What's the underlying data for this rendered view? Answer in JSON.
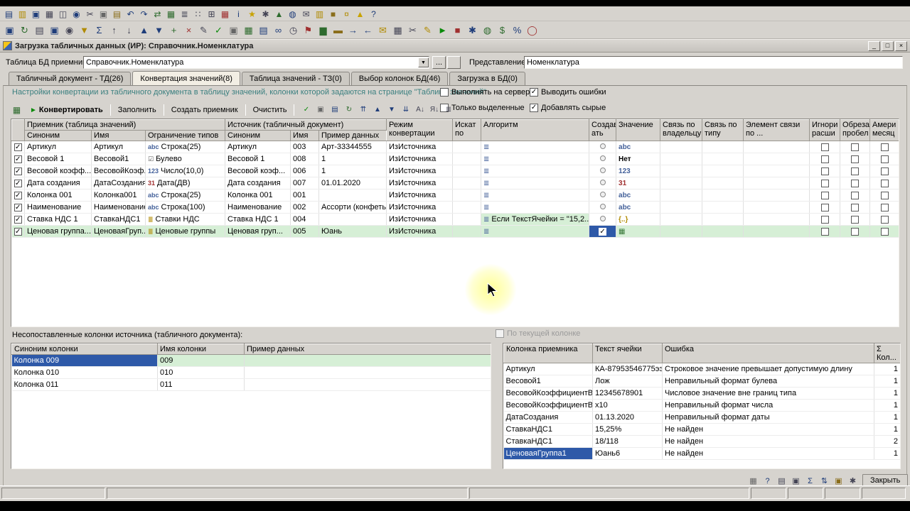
{
  "glyphs": {
    "check": "✓",
    "dropdown": "▼",
    "sigma": "Σ",
    "play": "►",
    "minimize": "_",
    "maximize": "□",
    "close": "×",
    "ellipsis": "...",
    "alg": "≣"
  },
  "window": {
    "title": "Загрузка табличных данных (ИР): Справочник.Номенклатура"
  },
  "form": {
    "table_label": "Таблица БД приемник:",
    "table_value": "Справочник.Номенклатура",
    "view_label": "Представление:",
    "view_value": "Номенклатура"
  },
  "tabs": [
    {
      "label": "Табличный документ - ТД(26)",
      "active": false
    },
    {
      "label": "Конвертация значений(8)",
      "active": true
    },
    {
      "label": "Таблица значений - ТЗ(0)",
      "active": false
    },
    {
      "label": "Выбор колонок БД(46)",
      "active": false
    },
    {
      "label": "Загрузка в БД(0)",
      "active": false
    }
  ],
  "info_text": "Настройки конвертации из табличного документа в таблицу значений, колонки которой задаются на странице \"Таблица значений\"",
  "options": {
    "run_on_server": {
      "label": "Выполнять на сервере",
      "checked": false
    },
    "show_errors": {
      "label": "Выводить ошибки",
      "checked": true
    },
    "only_selected": {
      "label": "Только выделенные",
      "checked": false
    },
    "add_raw": {
      "label": "Добавлять сырые",
      "checked": true
    }
  },
  "actions": {
    "convert": "Конвертировать",
    "fill": "Заполнить",
    "create_receiver": "Создать приемник",
    "clear": "Очистить"
  },
  "toolbars": {
    "row1": [
      [
        "new-document-icon",
        "▤",
        "#1f3d7a"
      ],
      [
        "open-icon",
        "▥",
        "#b08a00"
      ],
      [
        "save-icon",
        "▣",
        "#1f3d7a"
      ],
      [
        "print-icon",
        "▦",
        "#444455"
      ],
      [
        "print-preview-icon",
        "◫",
        "#444455"
      ],
      [
        "find-icon",
        "◉",
        "#1f3d7a"
      ],
      [
        "cut-icon",
        "✂",
        "#444455"
      ],
      [
        "copy-icon",
        "▣",
        "#666666"
      ],
      [
        "paste-icon",
        "▤",
        "#8a6d1a"
      ],
      [
        "undo-icon",
        "↶",
        "#1f3d7a"
      ],
      [
        "redo-icon",
        "↷",
        "#1f3d7a"
      ],
      [
        "compare-icon",
        "⇄",
        "#2e6b2e"
      ],
      [
        "table-icon",
        "▦",
        "#2e6b2e"
      ],
      [
        "list-icon",
        "≣",
        "#444455"
      ],
      [
        "tree-icon",
        "∷",
        "#444455"
      ],
      [
        "calculator-icon",
        "⊞",
        "#444455"
      ],
      [
        "calendar-icon",
        "▦",
        "#a03030"
      ],
      [
        "info-icon",
        "i",
        "#1f3d7a"
      ],
      [
        "star-icon",
        "★",
        "#c8a200"
      ],
      [
        "settings-icon",
        "✱",
        "#444455"
      ],
      [
        "chart-icon",
        "▲",
        "#2e6b2e"
      ],
      [
        "globe-icon",
        "◍",
        "#1f3d7a"
      ],
      [
        "mail-icon",
        "✉",
        "#444455"
      ],
      [
        "folder-icon",
        "▥",
        "#b08a00"
      ],
      [
        "lock-icon",
        "■",
        "#8a6d1a"
      ],
      [
        "key-icon",
        "¤",
        "#b08a00"
      ],
      [
        "warning-icon",
        "▲",
        "#c8a200"
      ],
      [
        "help-icon",
        "?",
        "#1f3d7a"
      ]
    ],
    "row2": [
      [
        "window-icon",
        "▣",
        "#1f3d7a"
      ],
      [
        "refresh-icon",
        "↻",
        "#2e6b2e"
      ],
      [
        "open-form-icon",
        "▤",
        "#444455"
      ],
      [
        "save-all-icon",
        "▣",
        "#1f3d7a"
      ],
      [
        "magnifier-icon",
        "◉",
        "#444455"
      ],
      [
        "filter-icon",
        "▼",
        "#b08a00"
      ],
      [
        "sum-icon",
        "Σ",
        "#1f3d7a"
      ],
      [
        "sort-asc-icon",
        "↑",
        "#444455"
      ],
      [
        "sort-desc-icon",
        "↓",
        "#444455"
      ],
      [
        "move-up-icon",
        "▲",
        "#1f3d7a"
      ],
      [
        "move-down-icon",
        "▼",
        "#1f3d7a"
      ],
      [
        "add-icon",
        "+",
        "#2e6b2e"
      ],
      [
        "delete-icon",
        "×",
        "#a03030"
      ],
      [
        "edit-icon",
        "✎",
        "#444455"
      ],
      [
        "check-icon",
        "✓",
        "#0a8a0a"
      ],
      [
        "copy-rows-icon",
        "▣",
        "#666666"
      ],
      [
        "excel-icon",
        "▦",
        "#2e6b2e"
      ],
      [
        "doc-icon",
        "▤",
        "#1f3d7a"
      ],
      [
        "link-icon",
        "∞",
        "#1f3d7a"
      ],
      [
        "clock-icon",
        "◷",
        "#444455"
      ],
      [
        "flag-icon",
        "⚑",
        "#a03030"
      ],
      [
        "chart-bars-icon",
        "▆",
        "#2e6b2e"
      ],
      [
        "database-icon",
        "▬",
        "#8a6d1a"
      ],
      [
        "export-icon",
        "→",
        "#1f3d7a"
      ],
      [
        "import-icon",
        "←",
        "#1f3d7a"
      ],
      [
        "mail-send-icon",
        "✉",
        "#b08a00"
      ],
      [
        "print-fast-icon",
        "▦",
        "#444455"
      ],
      [
        "scissors-icon",
        "✂",
        "#444455"
      ],
      [
        "brush-icon",
        "✎",
        "#b08a00"
      ],
      [
        "play-icon",
        "►",
        "#0a8a0a"
      ],
      [
        "stop-icon",
        "■",
        "#a03030"
      ],
      [
        "services-icon",
        "✱",
        "#1f3d7a"
      ],
      [
        "globe-web-icon",
        "◍",
        "#2e6b2e"
      ],
      [
        "money-icon",
        "$",
        "#2e6b2e"
      ],
      [
        "percent-icon",
        "%",
        "#1f3d7a"
      ],
      [
        "exit-icon",
        "◯",
        "#a03030"
      ]
    ],
    "action_icons": [
      [
        "check-document-icon",
        "✓",
        "#0a8a0a"
      ],
      [
        "copy-rows-icon",
        "▣",
        "#666666"
      ],
      [
        "new-row-icon",
        "▤",
        "#1f3d7a"
      ],
      [
        "refresh-rows-icon",
        "↻",
        "#2e6b2e"
      ],
      [
        "move-top-icon",
        "⇈",
        "#1f3d7a"
      ],
      [
        "move-up-icon",
        "▲",
        "#1f3d7a"
      ],
      [
        "move-down-icon",
        "▼",
        "#1f3d7a"
      ],
      [
        "move-bottom-icon",
        "⇊",
        "#1f3d7a"
      ],
      [
        "sort-az-icon",
        "А↓",
        "#444455"
      ],
      [
        "sort-za-icon",
        "Я↓",
        "#444455"
      ],
      [
        "list-icon",
        "≣",
        "#444455"
      ]
    ],
    "bottom_icons": [
      [
        "grid-settings-icon",
        "▦",
        "#666666"
      ],
      [
        "help-icon",
        "?",
        "#1f3d7a"
      ],
      [
        "document-icon",
        "▤",
        "#444455"
      ],
      [
        "documents-icon",
        "▣",
        "#444455"
      ],
      [
        "sum-icon",
        "Σ",
        "#1f3d7a"
      ],
      [
        "updown-icon",
        "⇅",
        "#1f3d7a"
      ],
      [
        "save-icon",
        "▣",
        "#8a6d1a"
      ],
      [
        "settings-icon",
        "✱",
        "#444455"
      ]
    ]
  },
  "main_table": {
    "groups": {
      "receiver": "Приемник (таблица значений)",
      "source": "Источник (табличный документ)"
    },
    "headers": {
      "syn": "Синоним",
      "name": "Имя",
      "type": "Ограничение типов",
      "src_syn": "Синоним",
      "src_name": "Имя",
      "sample": "Пример данных",
      "mode": "Режим конвертации",
      "search": "Искат по",
      "alg": "Алгоритм",
      "create": "Создав ать",
      "value": "Значение",
      "owner": "Связь по владельцу",
      "link_type": "Связь по типу",
      "element": "Элемент связи по ...",
      "ignore": "Игнори расши",
      "trim": "Обреза пробел",
      "amer": "Амери месяц"
    },
    "rows": [
      {
        "checked": true,
        "syn": "Артикул",
        "name": "Артикул",
        "type_glyph": "abc",
        "type_color": "#44619a",
        "type": "Строка(25)",
        "src_syn": "Артикул",
        "src_name": "003",
        "sample": "Арт-33344555",
        "mode": "ИзИсточника",
        "alg": "",
        "alg_green": false,
        "create_checked": false,
        "value_glyph": "abc",
        "value_color": "#44619a",
        "green": false
      },
      {
        "checked": true,
        "syn": "Весовой 1",
        "name": "Весовой1",
        "type_glyph": "☑",
        "type_color": "#555555",
        "type": "Булево",
        "src_syn": "Весовой 1",
        "src_name": "008",
        "sample": "1",
        "mode": "ИзИсточника",
        "alg": "",
        "alg_green": false,
        "create_checked": false,
        "value_glyph": "Нет",
        "value_color": "#000000",
        "green": false
      },
      {
        "checked": true,
        "syn": "Весовой коэфф...",
        "name": "ВесовойКоэф...",
        "type_glyph": "123",
        "type_color": "#44619a",
        "type": "Число(10,0)",
        "src_syn": "Весовой коэф...",
        "src_name": "006",
        "sample": "1",
        "mode": "ИзИсточника",
        "alg": "",
        "alg_green": false,
        "create_checked": false,
        "value_glyph": "123",
        "value_color": "#44619a",
        "green": false
      },
      {
        "checked": true,
        "syn": "Дата создания",
        "name": "ДатаСоздания",
        "type_glyph": "31",
        "type_color": "#a03030",
        "type": "Дата(ДВ)",
        "src_syn": "Дата создания",
        "src_name": "007",
        "sample": "01.01.2020",
        "mode": "ИзИсточника",
        "alg": "",
        "alg_green": false,
        "create_checked": false,
        "value_glyph": "31",
        "value_color": "#a03030",
        "green": false
      },
      {
        "checked": true,
        "syn": "Колонка 001",
        "name": "Колонка001",
        "type_glyph": "abc",
        "type_color": "#44619a",
        "type": "Строка(25)",
        "src_syn": "Колонка 001",
        "src_name": "001",
        "sample": "",
        "mode": "ИзИсточника",
        "alg": "",
        "alg_green": false,
        "create_checked": false,
        "value_glyph": "abc",
        "value_color": "#44619a",
        "green": false
      },
      {
        "checked": true,
        "syn": "Наименование",
        "name": "Наименование",
        "type_glyph": "abc",
        "type_color": "#44619a",
        "type": "Строка(100)",
        "src_syn": "Наименование",
        "src_name": "002",
        "sample": "Ассорти (конфеты)...",
        "mode": "ИзИсточника",
        "alg": "",
        "alg_green": false,
        "create_checked": false,
        "value_glyph": "abc",
        "value_color": "#44619a",
        "green": false
      },
      {
        "checked": true,
        "syn": "Ставка НДС 1",
        "name": "СтавкаНДС1",
        "type_glyph": "≣",
        "type_color": "#b08a00",
        "type": "Ставки НДС",
        "src_syn": "Ставка НДС 1",
        "src_name": "004",
        "sample": "",
        "mode": "ИзИсточника",
        "alg": "Если ТекстЯчейки = \"15,2..",
        "alg_green": true,
        "create_checked": false,
        "value_glyph": "{..}",
        "value_color": "#b08a00",
        "green": false
      },
      {
        "checked": true,
        "syn": "Ценовая группа...",
        "name": "ЦеноваяГруп...",
        "type_glyph": "≣",
        "type_color": "#b08a00",
        "type": "Ценовые группы",
        "src_syn": "Ценовая груп...",
        "src_name": "005",
        "sample": "Юань",
        "mode": "ИзИсточника",
        "alg": "",
        "alg_green": false,
        "create_checked": true,
        "value_glyph": "▦",
        "value_color": "#3a7a3a",
        "green": true
      }
    ]
  },
  "unmapped": {
    "title": "Несопоставленные колонки источника (табличного документа):",
    "columns": [
      "Синоним колонки",
      "Имя колонки",
      "Пример данных"
    ],
    "rows": [
      {
        "syn": "Колонка 009",
        "name": "009",
        "sample": "",
        "selected": true
      },
      {
        "syn": "Колонка 010",
        "name": "010",
        "sample": "",
        "selected": false
      },
      {
        "syn": "Колонка 011",
        "name": "011",
        "sample": "",
        "selected": false
      }
    ]
  },
  "errors": {
    "filter_label": "По текущей колонке",
    "columns": [
      "Колонка приемника",
      "Текст ячейки",
      "Ошибка",
      "Кол..."
    ],
    "rows": [
      {
        "col": "Артикул",
        "text": "КА-87953546775ээ...",
        "error": "Строковое значение превышает допустимую длину",
        "count": "1",
        "selected": false
      },
      {
        "col": "Весовой1",
        "text": "Лож",
        "error": "Неправильный формат булева",
        "count": "1",
        "selected": false
      },
      {
        "col": "ВесовойКоэффициентВ...",
        "text": "12345678901",
        "error": "Числовое значение вне границ типа",
        "count": "1",
        "selected": false
      },
      {
        "col": "ВесовойКоэффициентВ...",
        "text": "x10",
        "error": "Неправильный формат числа",
        "count": "1",
        "selected": false
      },
      {
        "col": "ДатаСоздания",
        "text": "01.13.2020",
        "error": "Неправильный формат даты",
        "count": "1",
        "selected": false
      },
      {
        "col": "СтавкаНДС1",
        "text": "15,25%",
        "error": "Не найден",
        "count": "1",
        "selected": false
      },
      {
        "col": "СтавкаНДС1",
        "text": "18/118",
        "error": "Не найден",
        "count": "2",
        "selected": false
      },
      {
        "col": "ЦеноваяГруппа1",
        "text": "Юань6",
        "error": "Не найден",
        "count": "1",
        "selected": true
      }
    ]
  },
  "close_label": "Закрыть"
}
